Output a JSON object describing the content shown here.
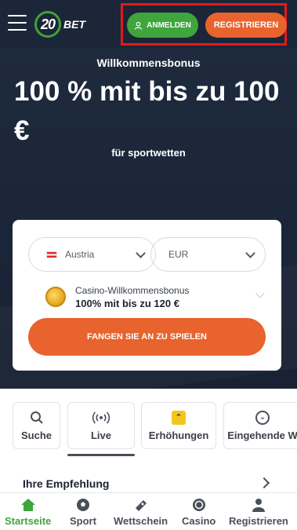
{
  "header": {
    "logo_number": "20",
    "logo_text": "BET",
    "login_label": "ANMELDEN",
    "register_label": "REGISTRIEREN",
    "icons": [
      "menu-icon",
      "user-icon"
    ]
  },
  "hero": {
    "subtitle": "Willkommensbonus",
    "title": "100 % mit bis zu 100 €",
    "for_text": "für sportwetten"
  },
  "form": {
    "country_value": "Austria",
    "currency_value": "EUR",
    "bonus_label": "Casino-Willkommensbonus",
    "bonus_value": "100% mit bis zu 120 €",
    "cta_label": "FANGEN SIE AN ZU SPIELEN"
  },
  "quick_links": {
    "items": [
      {
        "label": "Suche",
        "icon": "search-icon"
      },
      {
        "label": "Live",
        "icon": "live-icon"
      },
      {
        "label": "Erhöhungen",
        "icon": "boost-icon"
      },
      {
        "label": "Eingehende W",
        "icon": "incoming-icon"
      }
    ]
  },
  "recommendation": {
    "title": "Ihre Empfehlung"
  },
  "bottom_nav": {
    "items": [
      {
        "label": "Startseite",
        "icon": "home-icon",
        "active": true
      },
      {
        "label": "Sport",
        "icon": "soccer-ball-icon"
      },
      {
        "label": "Wettschein",
        "icon": "bet-slip-icon"
      },
      {
        "label": "Casino",
        "icon": "casino-chip-icon"
      },
      {
        "label": "Registrieren",
        "icon": "user-icon"
      }
    ]
  },
  "colors": {
    "header_bg": "#1b2638",
    "green": "#3fa53c",
    "orange": "#e8632d",
    "highlight_red": "#e11b1b"
  }
}
